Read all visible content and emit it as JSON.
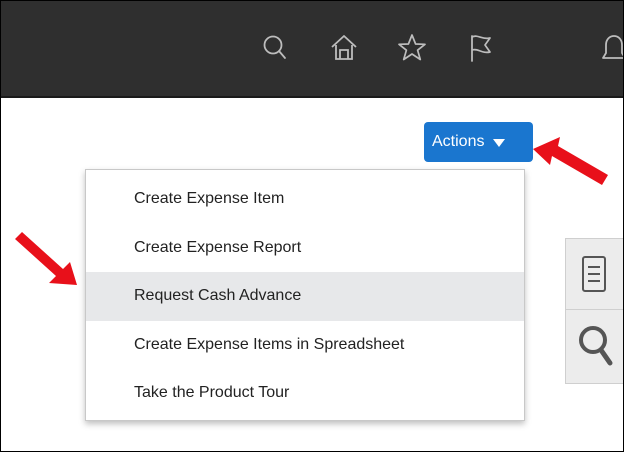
{
  "topbar": {
    "icons": [
      "search-icon",
      "home-icon",
      "star-icon",
      "flag-icon",
      "bell-icon"
    ]
  },
  "actions": {
    "label": "Actions"
  },
  "menu": {
    "items": [
      {
        "label": "Create Expense Item"
      },
      {
        "label": "Create Expense Report"
      },
      {
        "label": "Request Cash Advance"
      },
      {
        "label": "Create Expense Items in Spreadsheet"
      },
      {
        "label": "Take the Product Tour"
      }
    ],
    "highlighted_index": 2
  },
  "side_panel": {
    "icons": [
      "document-icon",
      "magnifier-icon"
    ]
  },
  "colors": {
    "topbar": "#2f2f2f",
    "accent": "#1a76cf",
    "highlight": "#e7e8ea",
    "annotation_arrow": "#e8101a"
  }
}
